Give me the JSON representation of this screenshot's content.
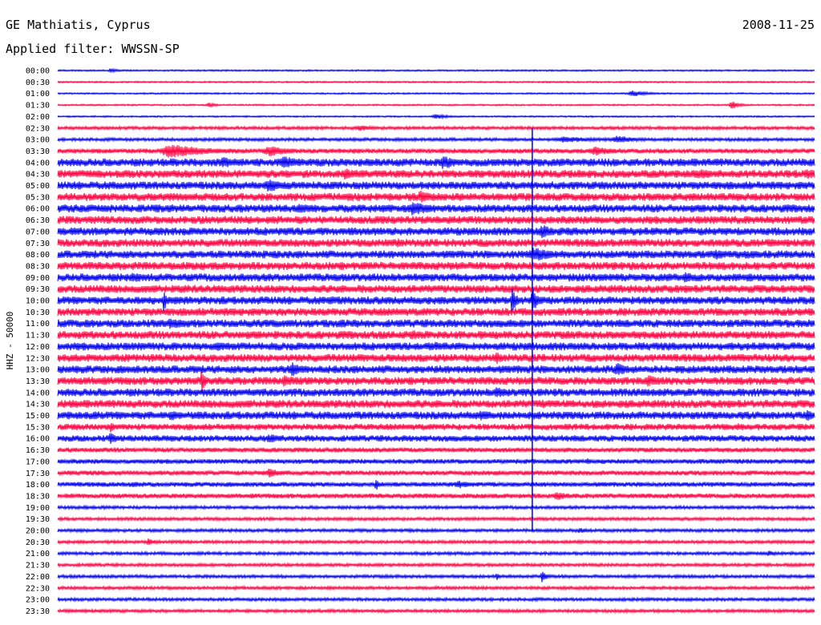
{
  "header": {
    "station": "GE Mathiatis, Cyprus",
    "date": "2008-11-25",
    "filter": "Applied filter: WWSSN-SP"
  },
  "chart_data": {
    "type": "line",
    "title": "GE Mathiatis, Cyprus",
    "ylabel": "HHZ - 50000",
    "colors": [
      "#0000ee",
      "#ff0040"
    ],
    "hours": [
      "00:00",
      "00:30",
      "01:00",
      "01:30",
      "02:00",
      "02:30",
      "03:00",
      "03:30",
      "04:00",
      "04:30",
      "05:00",
      "05:30",
      "06:00",
      "06:30",
      "07:00",
      "07:30",
      "08:00",
      "08:30",
      "09:00",
      "09:30",
      "10:00",
      "10:30",
      "11:00",
      "11:30",
      "12:00",
      "12:30",
      "13:00",
      "13:30",
      "14:00",
      "14:30",
      "15:00",
      "15:30",
      "16:00",
      "16:30",
      "17:00",
      "17:30",
      "18:00",
      "18:30",
      "19:00",
      "19:30",
      "20:00",
      "20:30",
      "21:00",
      "21:30",
      "22:00",
      "22:30",
      "23:00",
      "23:30"
    ],
    "background_level": [
      1,
      1,
      1,
      1,
      1,
      2,
      2,
      3,
      5,
      5,
      5,
      5,
      5,
      5,
      5,
      5,
      5,
      5,
      5,
      5,
      5,
      5,
      5,
      5,
      5,
      5,
      5,
      5,
      5,
      5,
      5,
      4,
      4,
      3,
      3,
      3,
      3,
      3,
      2,
      2,
      2,
      2,
      2,
      2,
      2,
      2,
      2,
      2
    ],
    "events": [
      {
        "row": 0,
        "x": 0.07,
        "amp": 3,
        "w": 0.01
      },
      {
        "row": 2,
        "x": 0.76,
        "amp": 4,
        "w": 0.02
      },
      {
        "row": 3,
        "x": 0.2,
        "amp": 3,
        "w": 0.01
      },
      {
        "row": 3,
        "x": 0.89,
        "amp": 6,
        "w": 0.01
      },
      {
        "row": 4,
        "x": 0.5,
        "amp": 3,
        "w": 0.02
      },
      {
        "row": 5,
        "x": 0.4,
        "amp": 4,
        "w": 0.02
      },
      {
        "row": 6,
        "x": 0.67,
        "amp": 4,
        "w": 0.05
      },
      {
        "row": 6,
        "x": 0.74,
        "amp": 5,
        "w": 0.03
      },
      {
        "row": 7,
        "x": 0.15,
        "amp": 9,
        "w": 0.05
      },
      {
        "row": 7,
        "x": 0.28,
        "amp": 7,
        "w": 0.03
      },
      {
        "row": 7,
        "x": 0.71,
        "amp": 6,
        "w": 0.03
      },
      {
        "row": 8,
        "x": 0.22,
        "amp": 7,
        "w": 0.03
      },
      {
        "row": 8,
        "x": 0.3,
        "amp": 8,
        "w": 0.03
      },
      {
        "row": 8,
        "x": 0.51,
        "amp": 9,
        "w": 0.02
      },
      {
        "row": 9,
        "x": 0.38,
        "amp": 8,
        "w": 0.02
      },
      {
        "row": 9,
        "x": 0.85,
        "amp": 6,
        "w": 0.04
      },
      {
        "row": 9,
        "x": 0.99,
        "amp": 7,
        "w": 0.02
      },
      {
        "row": 10,
        "x": 0.28,
        "amp": 8,
        "w": 0.03
      },
      {
        "row": 11,
        "x": 0.48,
        "amp": 8,
        "w": 0.02
      },
      {
        "row": 12,
        "x": 0.32,
        "amp": 7,
        "w": 0.02
      },
      {
        "row": 12,
        "x": 0.47,
        "amp": 9,
        "w": 0.03
      },
      {
        "row": 14,
        "x": 0.64,
        "amp": 9,
        "w": 0.02
      },
      {
        "row": 15,
        "x": 0.45,
        "amp": 6,
        "w": 0.01
      },
      {
        "row": 16,
        "x": 0.63,
        "amp": 9,
        "w": 0.03
      },
      {
        "row": 16,
        "x": 0.87,
        "amp": 7,
        "w": 0.02
      },
      {
        "row": 18,
        "x": 0.1,
        "amp": 6,
        "w": 0.03
      },
      {
        "row": 18,
        "x": 0.83,
        "amp": 7,
        "w": 0.02
      },
      {
        "row": 20,
        "x": 0.14,
        "amp": 14,
        "w": 0.005
      },
      {
        "row": 20,
        "x": 0.6,
        "amp": 22,
        "w": 0.005
      },
      {
        "row": 20,
        "x": 0.627,
        "amp": 22,
        "w": 0.005
      },
      {
        "row": 20,
        "x": 0.36,
        "amp": 6,
        "w": 0.02
      },
      {
        "row": 22,
        "x": 0.15,
        "amp": 7,
        "w": 0.03
      },
      {
        "row": 23,
        "x": 0.47,
        "amp": 6,
        "w": 0.03
      },
      {
        "row": 23,
        "x": 0.56,
        "amp": 6,
        "w": 0.02
      },
      {
        "row": 24,
        "x": 0.21,
        "amp": 6,
        "w": 0.03
      },
      {
        "row": 24,
        "x": 0.5,
        "amp": 6,
        "w": 0.02
      },
      {
        "row": 25,
        "x": 0.58,
        "amp": 8,
        "w": 0.01
      },
      {
        "row": 26,
        "x": 0.31,
        "amp": 9,
        "w": 0.02
      },
      {
        "row": 26,
        "x": 0.74,
        "amp": 8,
        "w": 0.02
      },
      {
        "row": 27,
        "x": 0.19,
        "amp": 16,
        "w": 0.005
      },
      {
        "row": 27,
        "x": 0.3,
        "amp": 8,
        "w": 0.02
      },
      {
        "row": 27,
        "x": 0.78,
        "amp": 8,
        "w": 0.02
      },
      {
        "row": 28,
        "x": 0.58,
        "amp": 7,
        "w": 0.02
      },
      {
        "row": 29,
        "x": 0.64,
        "amp": 6,
        "w": 0.02
      },
      {
        "row": 30,
        "x": 0.15,
        "amp": 7,
        "w": 0.02
      },
      {
        "row": 30,
        "x": 0.56,
        "amp": 7,
        "w": 0.02
      },
      {
        "row": 30,
        "x": 0.99,
        "amp": 8,
        "w": 0.01
      },
      {
        "row": 31,
        "x": 0.07,
        "amp": 8,
        "w": 0.005
      },
      {
        "row": 31,
        "x": 0.9,
        "amp": 5,
        "w": 0.02
      },
      {
        "row": 32,
        "x": 0.07,
        "amp": 8,
        "w": 0.01
      },
      {
        "row": 32,
        "x": 0.28,
        "amp": 6,
        "w": 0.02
      },
      {
        "row": 34,
        "x": 0.7,
        "amp": 4,
        "w": 0.01
      },
      {
        "row": 35,
        "x": 0.28,
        "amp": 6,
        "w": 0.02
      },
      {
        "row": 36,
        "x": 0.42,
        "amp": 9,
        "w": 0.005
      },
      {
        "row": 36,
        "x": 0.53,
        "amp": 5,
        "w": 0.02
      },
      {
        "row": 36,
        "x": 0.1,
        "amp": 4,
        "w": 0.02
      },
      {
        "row": 37,
        "x": 0.66,
        "amp": 6,
        "w": 0.02
      },
      {
        "row": 40,
        "x": 0.69,
        "amp": 4,
        "w": 0.01
      },
      {
        "row": 41,
        "x": 0.12,
        "amp": 5,
        "w": 0.01
      },
      {
        "row": 42,
        "x": 0.94,
        "amp": 4,
        "w": 0.01
      },
      {
        "row": 44,
        "x": 0.58,
        "amp": 5,
        "w": 0.005
      },
      {
        "row": 44,
        "x": 0.64,
        "amp": 9,
        "w": 0.005
      }
    ],
    "long_spike": {
      "x": 0.627,
      "from_hour": "02:30",
      "to_hour": "20:00"
    }
  }
}
